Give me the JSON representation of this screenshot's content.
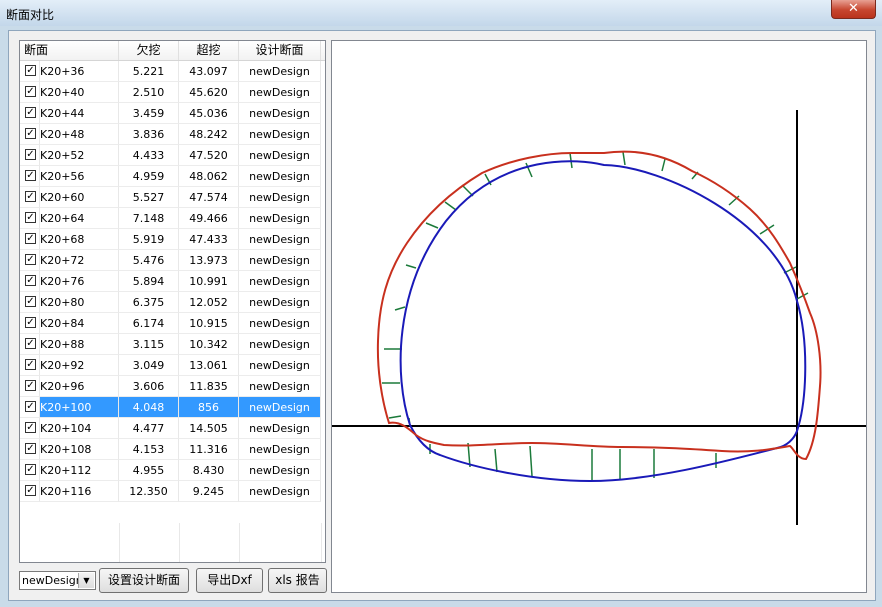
{
  "window": {
    "title": "断面对比",
    "close_label": "✕"
  },
  "list": {
    "columns": [
      "断面",
      "欠挖",
      "超挖",
      "设计断面"
    ],
    "rows": [
      {
        "section": "K20+36",
        "under": "5.221",
        "over": "43.097",
        "design": "newDesign",
        "checked": true
      },
      {
        "section": "K20+40",
        "under": "2.510",
        "over": "45.620",
        "design": "newDesign",
        "checked": true
      },
      {
        "section": "K20+44",
        "under": "3.459",
        "over": "45.036",
        "design": "newDesign",
        "checked": true
      },
      {
        "section": "K20+48",
        "under": "3.836",
        "over": "48.242",
        "design": "newDesign",
        "checked": true
      },
      {
        "section": "K20+52",
        "under": "4.433",
        "over": "47.520",
        "design": "newDesign",
        "checked": true
      },
      {
        "section": "K20+56",
        "under": "4.959",
        "over": "48.062",
        "design": "newDesign",
        "checked": true
      },
      {
        "section": "K20+60",
        "under": "5.527",
        "over": "47.574",
        "design": "newDesign",
        "checked": true
      },
      {
        "section": "K20+64",
        "under": "7.148",
        "over": "49.466",
        "design": "newDesign",
        "checked": true
      },
      {
        "section": "K20+68",
        "under": "5.919",
        "over": "47.433",
        "design": "newDesign",
        "checked": true
      },
      {
        "section": "K20+72",
        "under": "5.476",
        "over": "13.973",
        "design": "newDesign",
        "checked": true
      },
      {
        "section": "K20+76",
        "under": "5.894",
        "over": "10.991",
        "design": "newDesign",
        "checked": true
      },
      {
        "section": "K20+80",
        "under": "6.375",
        "over": "12.052",
        "design": "newDesign",
        "checked": true
      },
      {
        "section": "K20+84",
        "under": "6.174",
        "over": "10.915",
        "design": "newDesign",
        "checked": true
      },
      {
        "section": "K20+88",
        "under": "3.115",
        "over": "10.342",
        "design": "newDesign",
        "checked": true
      },
      {
        "section": "K20+92",
        "under": "3.049",
        "over": "13.061",
        "design": "newDesign",
        "checked": true
      },
      {
        "section": "K20+96",
        "under": "3.606",
        "over": "11.835",
        "design": "newDesign",
        "checked": true
      },
      {
        "section": "K20+100",
        "under": "4.048",
        "over": "856",
        "design": "newDesign",
        "checked": true,
        "selected": true
      },
      {
        "section": "K20+104",
        "under": "4.477",
        "over": "14.505",
        "design": "newDesign",
        "checked": true
      },
      {
        "section": "K20+108",
        "under": "4.153",
        "over": "11.316",
        "design": "newDesign",
        "checked": true
      },
      {
        "section": "K20+112",
        "under": "4.955",
        "over": "8.430",
        "design": "newDesign",
        "checked": true
      },
      {
        "section": "K20+116",
        "under": "12.350",
        "over": "9.245",
        "design": "newDesign",
        "checked": true
      }
    ]
  },
  "controls": {
    "design_select_value": "newDesign",
    "set_design_button": "设置设计断面",
    "export_dxf_button": "导出Dxf",
    "xls_report_button": "xls 报告"
  },
  "canvas": {
    "colors": {
      "design": "#1a1ab8",
      "actual": "#c8301e",
      "offset": "#1b7a3a",
      "axis": "#000000"
    }
  }
}
